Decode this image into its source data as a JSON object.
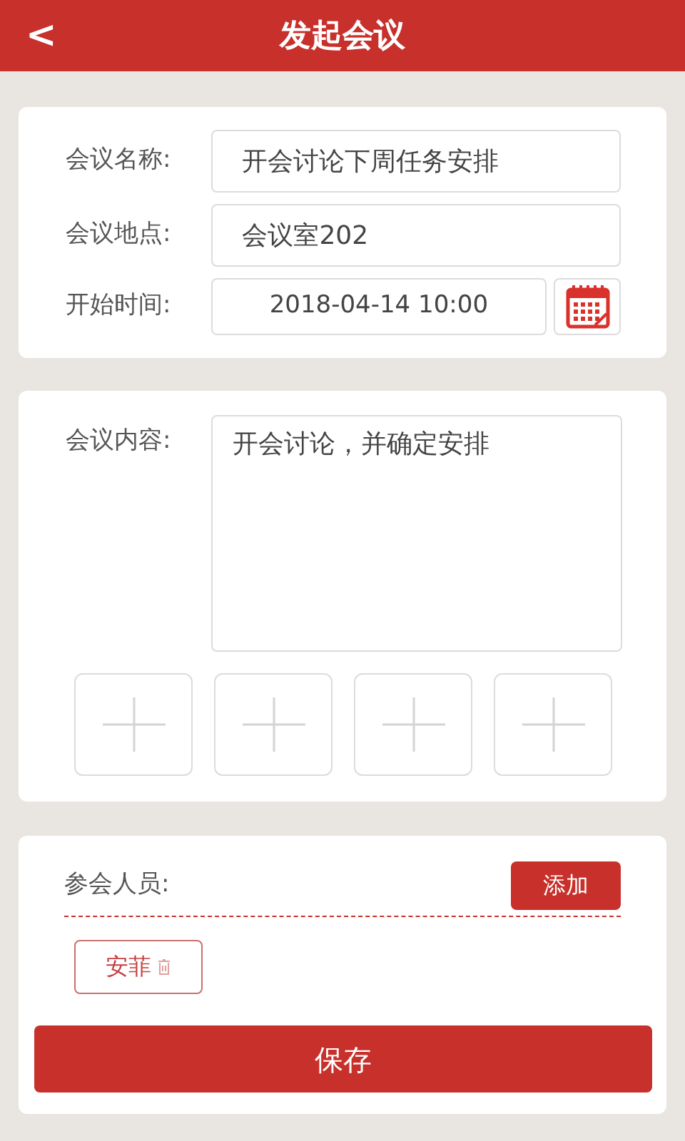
{
  "header": {
    "back": "<",
    "title": "发起会议"
  },
  "basic_info": {
    "fields": [
      {
        "label": "会议名称:",
        "value": "开会讨论下周任务安排",
        "kind": "text"
      },
      {
        "label": "会议地点:",
        "value": "会议室202",
        "kind": "text"
      },
      {
        "label": "开始时间:",
        "value": "2018-04-14 10:00",
        "kind": "date"
      }
    ]
  },
  "content": {
    "label": "会议内容:",
    "value": "开会讨论，并确定安排",
    "upload_slots": [
      {
        "kind": "add"
      },
      {
        "kind": "add"
      },
      {
        "kind": "add"
      },
      {
        "kind": "add"
      }
    ]
  },
  "attendees": {
    "label": "参会人员:",
    "add_button": "添加",
    "people": [
      {
        "name": "安菲"
      }
    ]
  },
  "save_button": "保存"
}
